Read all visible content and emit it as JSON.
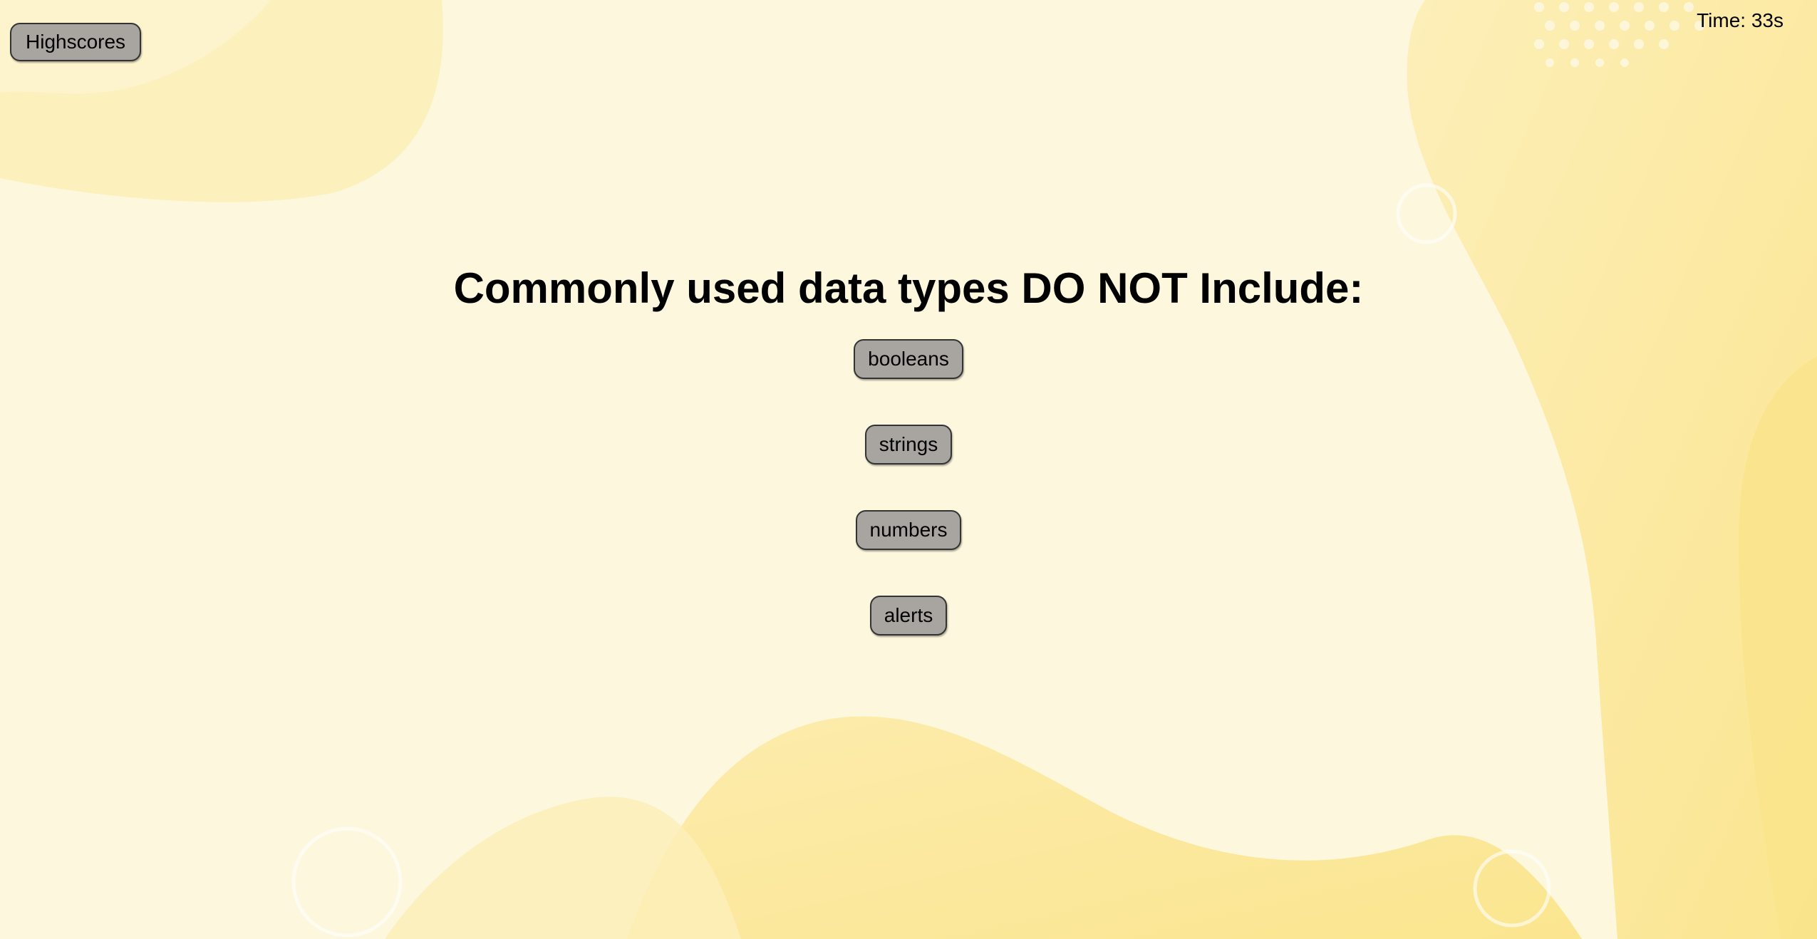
{
  "header": {
    "highscores_label": "Highscores",
    "timer_text": "Time: 33s"
  },
  "quiz": {
    "question": "Commonly used data types DO NOT Include:",
    "choices": [
      {
        "label": "booleans"
      },
      {
        "label": "strings"
      },
      {
        "label": "numbers"
      },
      {
        "label": "alerts"
      }
    ]
  },
  "colors": {
    "background": "#fdf7dd",
    "blob": "#fbe9a3",
    "button": "#a8a5a0"
  }
}
